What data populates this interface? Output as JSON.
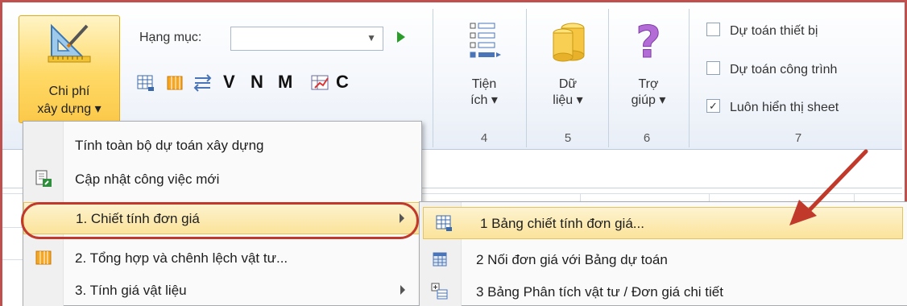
{
  "ribbon": {
    "chi_phi": {
      "line1": "Chi phí",
      "line2": "xây dựng ▾"
    },
    "hang_muc_label": "Hạng mục:",
    "letters": [
      "V",
      "N",
      "M",
      "C"
    ],
    "tien_ich": {
      "line1": "Tiện",
      "line2": "ích ▾"
    },
    "du_lieu": {
      "line1": "Dữ",
      "line2": "liệu ▾"
    },
    "tro_giup": {
      "line1": "Trợ",
      "line2": "giúp ▾"
    },
    "group_numbers": [
      "4",
      "5",
      "6",
      "7"
    ],
    "checkboxes": [
      {
        "label": "Dự toán thiết bị",
        "checked": false
      },
      {
        "label": "Dự toán công trình",
        "checked": false
      },
      {
        "label": "Luôn hiển thị sheet",
        "checked": true
      }
    ]
  },
  "menu": {
    "items": [
      {
        "label": "Tính toàn bộ dự toán xây dựng",
        "icon": "none"
      },
      {
        "label": "Cập nhật công việc mới",
        "icon": "update-doc-icon"
      },
      {
        "label": "1. Chiết tính đơn giá",
        "icon": "none",
        "submenu": true,
        "highlighted": true
      },
      {
        "label": "2. Tổng hợp và chênh lệch vật tư...",
        "icon": "columns-icon"
      },
      {
        "label": "3. Tính giá vật liệu",
        "icon": "none",
        "submenu": true
      }
    ]
  },
  "submenu": {
    "items": [
      {
        "label": "1 Bảng chiết tính đơn giá...",
        "icon": "table-icon",
        "highlighted": true
      },
      {
        "label": "2 Nối đơn giá với Bảng dự toán",
        "icon": "grid-icon"
      },
      {
        "label": "3 Bảng Phân tích vật tư / Đơn giá chi tiết",
        "icon": "expand-table-icon"
      }
    ]
  },
  "colors": {
    "annotation": "#c0392b",
    "highlight": "#fbe39a",
    "frame": "#c0504d"
  }
}
